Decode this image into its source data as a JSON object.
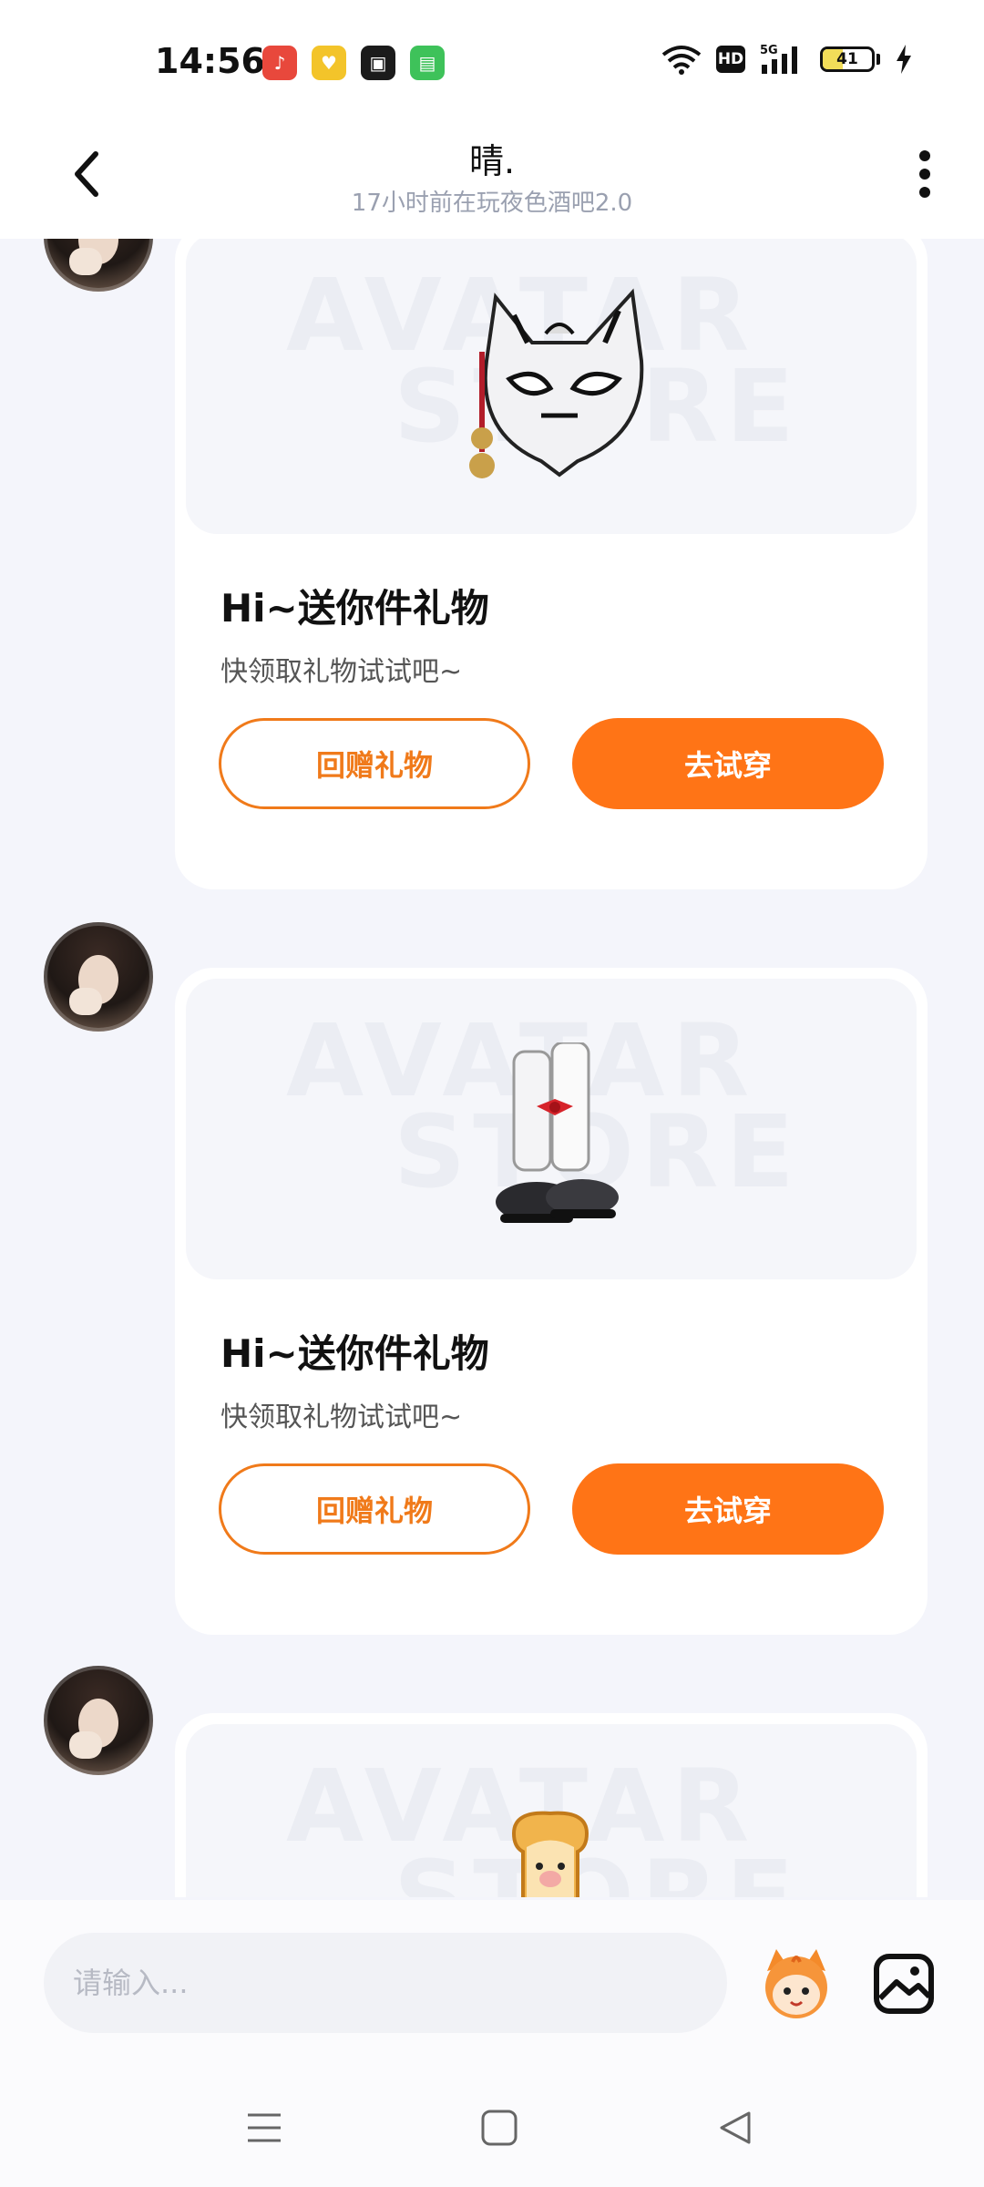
{
  "status_bar": {
    "time": "14:56",
    "battery_level": "41",
    "battery_fraction": 0.41,
    "network": "5G",
    "hd_badge": "HD",
    "app_icons": [
      "music-app-icon",
      "yellow-app-icon",
      "news-app-icon",
      "message-app-icon"
    ]
  },
  "header": {
    "name": "晴.",
    "status": "17小时前在玩夜色酒吧2.0"
  },
  "messages": [
    {
      "title": "Hi~送你件礼物",
      "subtitle": "快领取礼物试试吧~",
      "return_button": "回赠礼物",
      "try_button": "去试穿",
      "gift_icon": "fox-mask-icon"
    },
    {
      "title": "Hi~送你件礼物",
      "subtitle": "快领取礼物试试吧~",
      "return_button": "回赠礼物",
      "try_button": "去试穿",
      "gift_icon": "leg-warmers-shoes-icon"
    },
    {
      "gift_icon": "toast-icon"
    }
  ],
  "watermark": {
    "line1": "AVATAR",
    "line2": "STORE"
  },
  "input": {
    "placeholder": "请输入..."
  },
  "colors": {
    "accent": "#ff7416",
    "background": "#f4f5fb",
    "card": "#ffffff"
  }
}
